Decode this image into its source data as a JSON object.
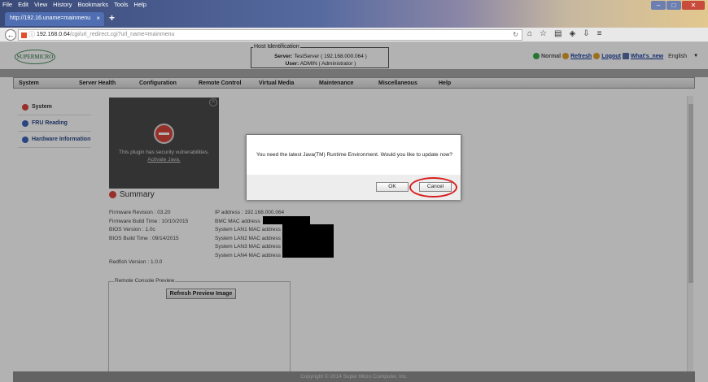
{
  "browser": {
    "menu": [
      "File",
      "Edit",
      "View",
      "History",
      "Bookmarks",
      "Tools",
      "Help"
    ],
    "tab_title": "http://192.16.uname=mainmenu",
    "tab_close": "×",
    "new_tab": "+",
    "url_host": "192.168.0.64",
    "url_path": "/cgi/url_redirect.cgi?url_name=mainmenu",
    "toolbar_icons": [
      "reload-icon",
      "home-icon",
      "star-icon",
      "bookmarks-icon",
      "pocket-icon",
      "download-icon",
      "menu-icon"
    ]
  },
  "header": {
    "logo_text": "SUPERMICRO",
    "host_legend": "Host Identification",
    "server_label": "Server:",
    "server_value": "TestServer ( 192.168.000.064 )",
    "user_label": "User:",
    "user_value": "ADMIN",
    "user_role": "( Administrator )",
    "status": "Normal",
    "refresh": "Refresh",
    "logout": "Logout",
    "whats_new": "What's_new",
    "language": "English",
    "language_arrow": "▼"
  },
  "menu": {
    "items": [
      "System",
      "Server Health",
      "Configuration",
      "Remote Control",
      "Virtual Media",
      "Maintenance",
      "Miscellaneous",
      "Help"
    ]
  },
  "sidebar": {
    "items": [
      {
        "label": "System",
        "color": "#d8463a"
      },
      {
        "label": "FRU Reading",
        "color": "#3b66b8"
      },
      {
        "label": "Hardware Information",
        "color": "#3b66b8"
      }
    ]
  },
  "plugin": {
    "close": "×",
    "message": "This plugin has security vulnerabilities.",
    "action": "Activate Java."
  },
  "summary": {
    "title": "Summary",
    "firmware_revision": "Firmware Revision : 03.20",
    "firmware_build": "Firmware Build Time : 10/10/2015",
    "bios_version": "BIOS Version : 1.0c",
    "bios_build": "BIOS Build Time : 09/14/2015",
    "redfish": "Redfish Version : 1.0.0",
    "ip": "IP address : 192.168.000.064",
    "bmc_mac": "BMC MAC address",
    "lan1": "System LAN1 MAC address",
    "lan2": "System LAN2 MAC address",
    "lan3": "System LAN3 MAC address",
    "lan4": "System LAN4 MAC address"
  },
  "preview": {
    "legend": "Remote Console Preview",
    "refresh_button": "Refresh Preview Image"
  },
  "footer": {
    "copyright": "Copyright © 2014 Super Micro Computer, Inc."
  },
  "dialog": {
    "message": "You need the latest Java(TM) Runtime Environment. Would you like to update now?",
    "ok": "OK",
    "cancel": "Cancel"
  },
  "colors": {
    "highlight_ring": "#d81e1e",
    "status_ok": "#3aa84a"
  }
}
